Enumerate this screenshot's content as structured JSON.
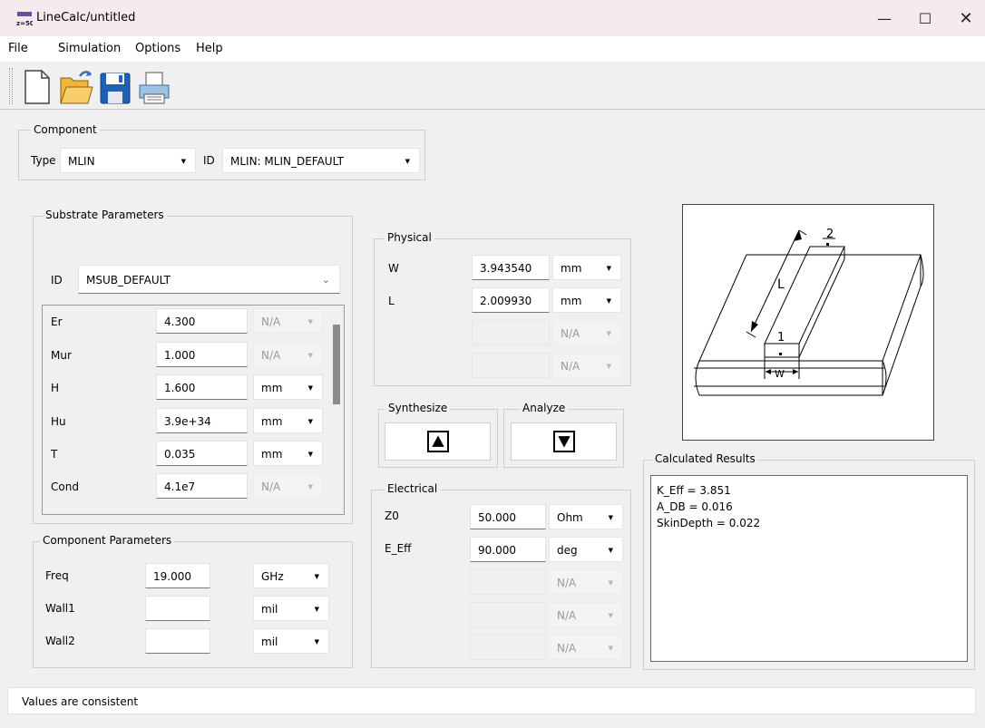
{
  "window": {
    "title": "LineCalc/untitled",
    "icon_text": "z=50",
    "controls": [
      "minimize-icon",
      "maximize-icon",
      "close-icon"
    ]
  },
  "menu": {
    "items": [
      "File",
      "Simulation",
      "Options",
      "Help"
    ]
  },
  "toolbar": {
    "icons": [
      "new-file-icon",
      "open-folder-icon",
      "save-disk-icon",
      "print-icon"
    ]
  },
  "component": {
    "group_label": "Component",
    "type_label": "Type",
    "type_value": "MLIN",
    "id_label": "ID",
    "id_value": "MLIN: MLIN_DEFAULT"
  },
  "substrate": {
    "group_label": "Substrate Parameters",
    "id_label": "ID",
    "id_value": "MSUB_DEFAULT",
    "rows": [
      {
        "name": "Er",
        "value": "4.300",
        "unit": "N/A",
        "unit_enabled": false
      },
      {
        "name": "Mur",
        "value": "1.000",
        "unit": "N/A",
        "unit_enabled": false
      },
      {
        "name": "H",
        "value": "1.600",
        "unit": "mm",
        "unit_enabled": true
      },
      {
        "name": "Hu",
        "value": "3.9e+34",
        "unit": "mm",
        "unit_enabled": true
      },
      {
        "name": "T",
        "value": "0.035",
        "unit": "mm",
        "unit_enabled": true
      },
      {
        "name": "Cond",
        "value": "4.1e7",
        "unit": "N/A",
        "unit_enabled": false
      }
    ]
  },
  "component_params": {
    "group_label": "Component Parameters",
    "rows": [
      {
        "name": "Freq",
        "value": "19.000",
        "unit": "GHz"
      },
      {
        "name": "Wall1",
        "value": "",
        "unit": "mil"
      },
      {
        "name": "Wall2",
        "value": "",
        "unit": "mil"
      }
    ]
  },
  "physical": {
    "group_label": "Physical",
    "rows": [
      {
        "name": "W",
        "value": "3.943540",
        "unit": "mm",
        "unit_enabled": true
      },
      {
        "name": "L",
        "value": "2.009930",
        "unit": "mm",
        "unit_enabled": true
      },
      {
        "name": "",
        "value": "",
        "unit": "N/A",
        "unit_enabled": false
      },
      {
        "name": "",
        "value": "",
        "unit": "N/A",
        "unit_enabled": false
      }
    ]
  },
  "synthesize": {
    "label": "Synthesize",
    "icon": "arrow-up-icon"
  },
  "analyze": {
    "label": "Analyze",
    "icon": "arrow-down-icon"
  },
  "electrical": {
    "group_label": "Electrical",
    "rows": [
      {
        "name": "Z0",
        "value": "50.000",
        "unit": "Ohm",
        "unit_enabled": true
      },
      {
        "name": "E_Eff",
        "value": "90.000",
        "unit": "deg",
        "unit_enabled": true
      },
      {
        "name": "",
        "value": "",
        "unit": "N/A",
        "unit_enabled": false
      },
      {
        "name": "",
        "value": "",
        "unit": "N/A",
        "unit_enabled": false
      },
      {
        "name": "",
        "value": "",
        "unit": "N/A",
        "unit_enabled": false
      }
    ]
  },
  "diagram": {
    "label_L": "L",
    "label_W": "W",
    "port1": "1",
    "port2": "2"
  },
  "results": {
    "group_label": "Calculated Results",
    "lines": [
      "K_Eff = 3.851",
      "A_DB = 0.016",
      "SkinDepth = 0.022"
    ]
  },
  "status": {
    "text": "Values are consistent"
  }
}
